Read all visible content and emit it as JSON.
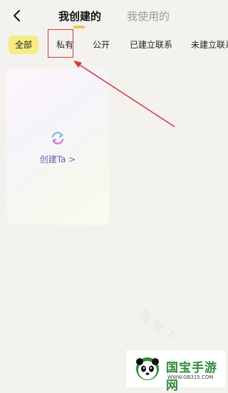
{
  "header": {
    "back_icon": "back-chevron-icon",
    "tabs": [
      {
        "label": "我创建的",
        "active": true
      },
      {
        "label": "我使用的",
        "active": false
      }
    ]
  },
  "filters": {
    "chips": [
      "全部",
      "私有",
      "公开",
      "已建立联系",
      "未建立联系"
    ],
    "selected": "全部"
  },
  "card": {
    "icon": "refresh-icon",
    "label": "创建Ta >"
  },
  "watermark": {
    "site_name": "国宝手游网",
    "site_url": "WWW.GB315.COM",
    "overlay_text": "简单下"
  },
  "colors": {
    "selected_chip": "#f6ec83",
    "annotation_red": "#d5363a",
    "card_label": "#6b62b3"
  }
}
